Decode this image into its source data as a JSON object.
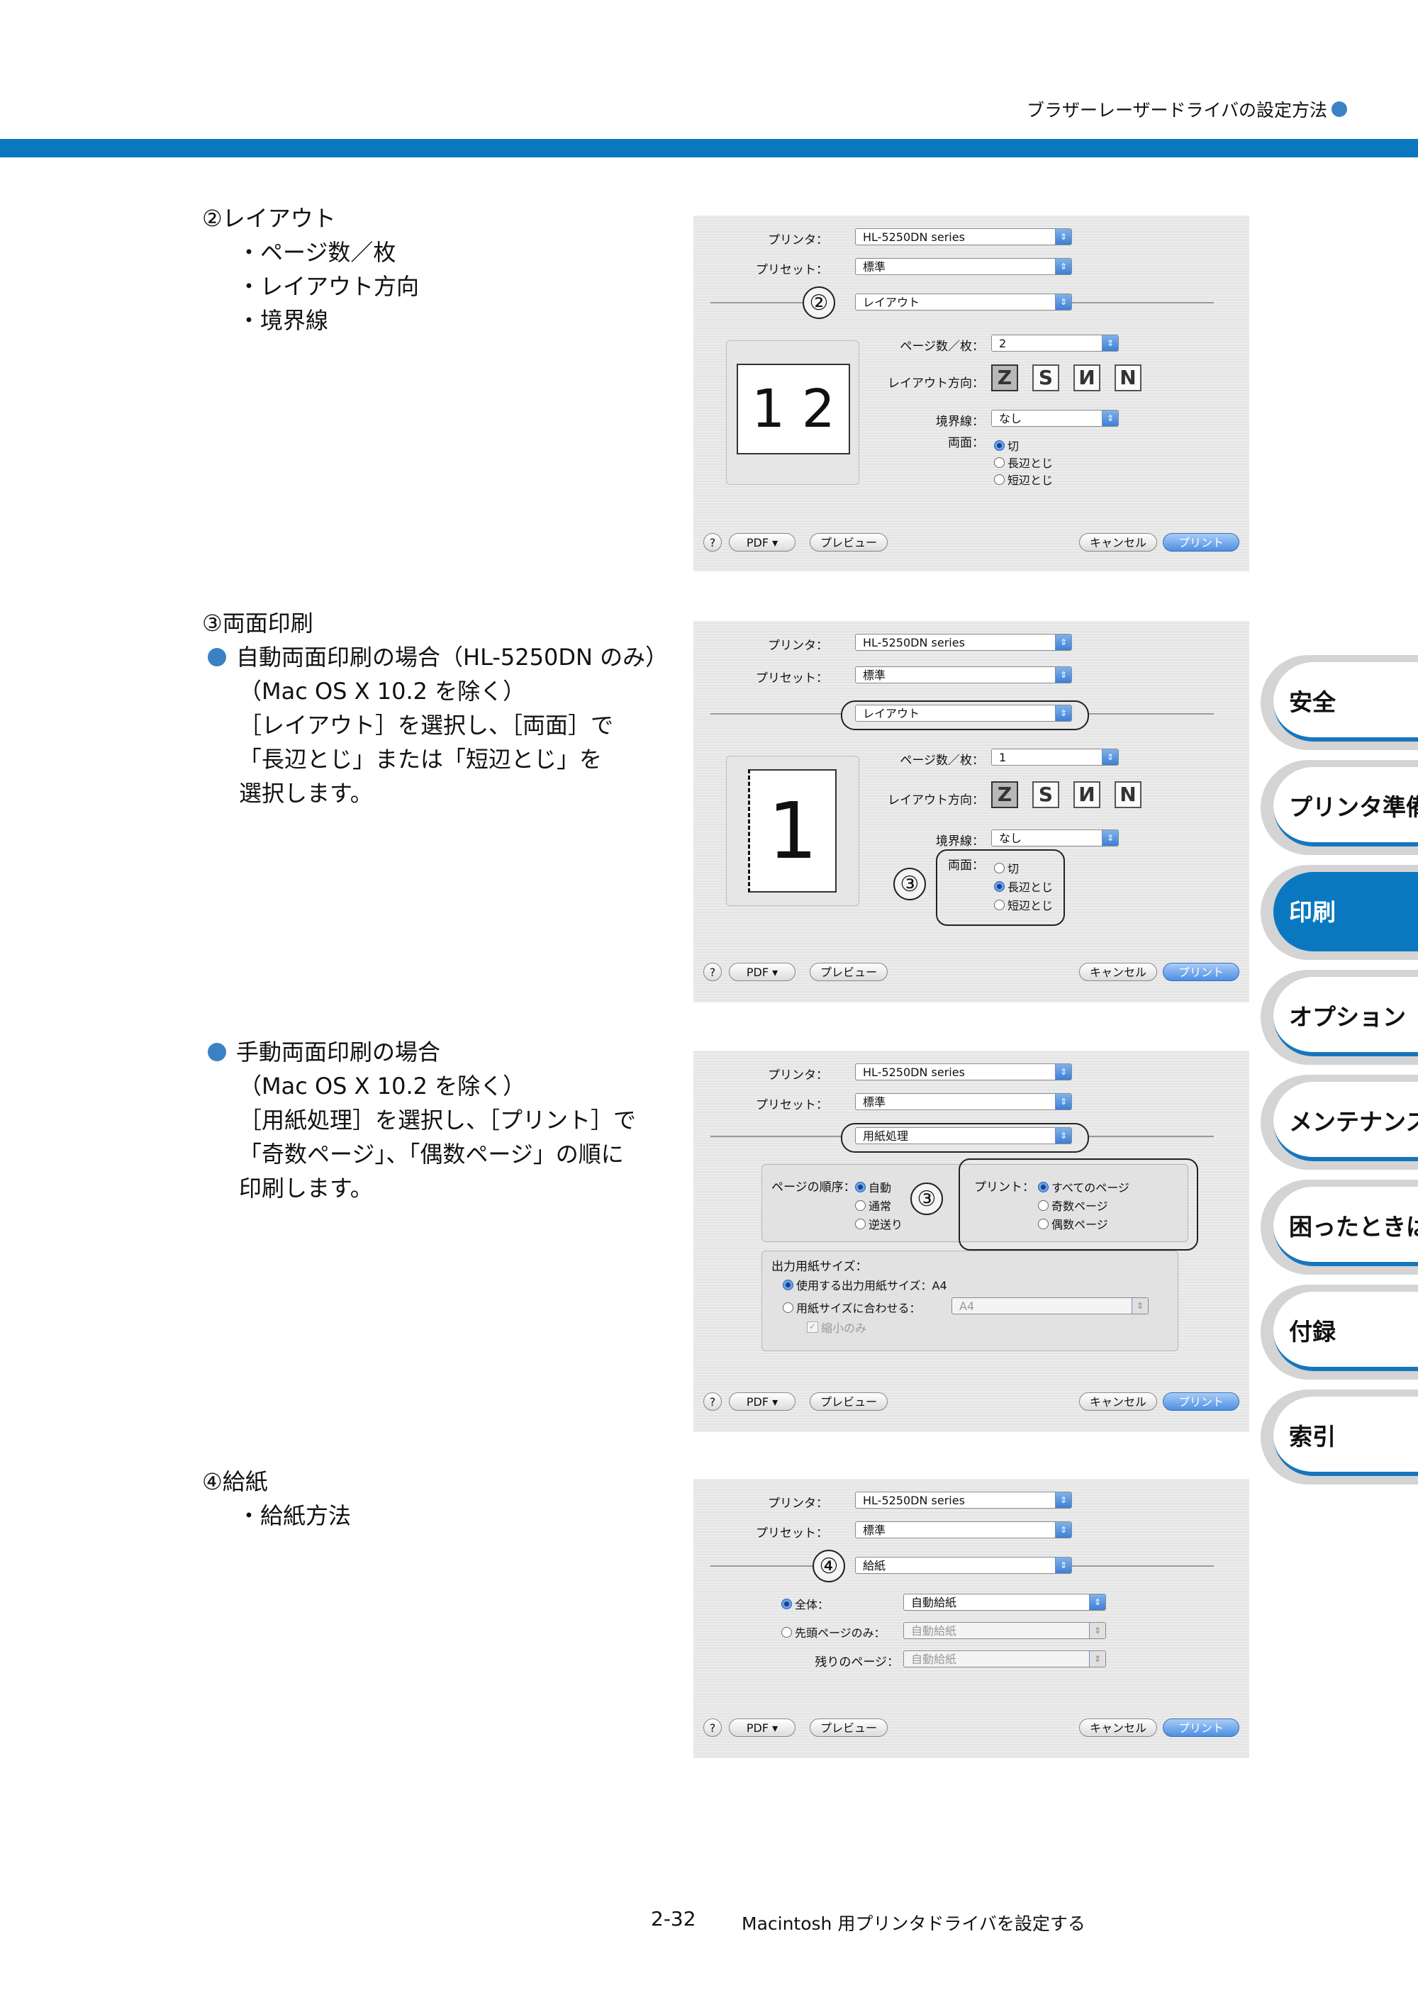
{
  "header": {
    "title": "ブラザーレーザードライバの設定方法"
  },
  "sections": {
    "layout": {
      "title": "②レイアウト",
      "items": [
        "・ページ数／枚",
        "・レイアウト方向",
        "・境界線"
      ]
    },
    "duplex": {
      "title": "③両面印刷",
      "auto_title": "自動両面印刷の場合（HL-5250DN のみ）",
      "auto_lines": [
        "（Mac OS X 10.2 を除く）",
        "［レイアウト］を選択し、［両面］で",
        "「長辺とじ」または「短辺とじ」を",
        "選択します。"
      ],
      "manual_title": "手動両面印刷の場合",
      "manual_lines": [
        "（Mac OS X 10.2 を除く）",
        "［用紙処理］を選択し、［プリント］で",
        "「奇数ページ」、「偶数ページ」の順に",
        "印刷します。"
      ]
    },
    "feed": {
      "title": "④給紙",
      "items": [
        "・給紙方法"
      ]
    }
  },
  "dialog_common": {
    "printer_label": "プリンタ：",
    "printer_value": "HL-5250DN series",
    "preset_label": "プリセット：",
    "preset_value": "標準",
    "help": "?",
    "pdf_button": "PDF ▾",
    "preview_button": "プレビュー",
    "cancel_button": "キャンセル",
    "print_button": "プリント"
  },
  "dialog1": {
    "panel": "レイアウト",
    "callout": "②",
    "pages_label": "ページ数／枚：",
    "pages_value": "2",
    "direction_label": "レイアウト方向：",
    "border_label": "境界線：",
    "border_value": "なし",
    "duplex_label": "両面：",
    "duplex_options": [
      "切",
      "長辺とじ",
      "短辺とじ"
    ],
    "duplex_selected": 0,
    "preview_text": "1 2"
  },
  "dialog2": {
    "panel": "レイアウト",
    "callout": "③",
    "pages_label": "ページ数／枚：",
    "pages_value": "1",
    "direction_label": "レイアウト方向：",
    "border_label": "境界線：",
    "border_value": "なし",
    "duplex_label": "両面：",
    "duplex_options": [
      "切",
      "長辺とじ",
      "短辺とじ"
    ],
    "duplex_selected": 1,
    "preview_text": "1"
  },
  "dialog3": {
    "panel": "用紙処理",
    "callout": "③",
    "order_label": "ページの順序：",
    "order_options": [
      "自動",
      "通常",
      "逆送り"
    ],
    "print_label": "プリント：",
    "print_options": [
      "すべてのページ",
      "奇数ページ",
      "偶数ページ"
    ],
    "paper_size_title": "出力用紙サイズ：",
    "use_size": "使用する出力用紙サイズ：A4",
    "fit_size": "用紙サイズに合わせる：",
    "fit_value": "A4",
    "shrink_only": "縮小のみ"
  },
  "dialog4": {
    "panel": "給紙",
    "callout": "④",
    "all_label": "全体：",
    "all_value": "自動給紙",
    "first_label": "先頭ページのみ：",
    "first_value": "自動給紙",
    "rest_label": "残りのページ：",
    "rest_value": "自動給紙"
  },
  "side_tabs": [
    "安全",
    "プリンタ準備",
    "印刷",
    "オプション",
    "メンテナンス",
    "困ったときは",
    "付録",
    "索引"
  ],
  "active_tab": "印刷",
  "footer": {
    "page": "2-32",
    "title": "Macintosh 用プリンタドライバを設定する"
  }
}
